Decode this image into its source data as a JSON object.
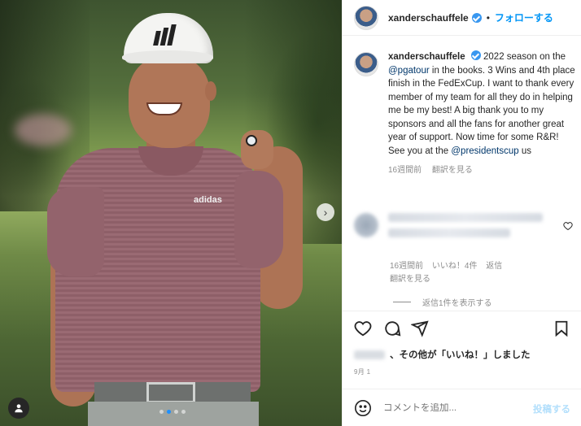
{
  "post": {
    "username": "xanderschauffele",
    "follow_label": "フォローする",
    "separator": "•",
    "caption": {
      "part1": " 2022 season on the ",
      "mention1": "@pgatour",
      "part2": " in the books. 3 Wins and 4th place finish in the FedExCup. I want to thank every member of my team for all they do in helping me be my best! A big thank you to my sponsors and all the fans for another great year of support. Now time for some R&R! See you at the ",
      "mention2": "@presidentscup",
      "part3": " us"
    },
    "caption_meta": {
      "age": "16週間前",
      "translate": "翻訳を見る"
    },
    "comment_meta": {
      "age": "16週間前",
      "likes": "いいね！4件",
      "reply": "返信",
      "translate": "翻訳を見る"
    },
    "view_replies": "返信1件を表示する",
    "likes_text": "、その他が「いいね！」しました",
    "date": "9月 1",
    "add_comment_placeholder": "コメントを追加...",
    "post_button": "投稿する",
    "photo_text": {
      "brand": "adidas"
    }
  },
  "carousel": {
    "count": 4,
    "active_index": 1
  },
  "colors": {
    "accent": "#0095f6",
    "verified": "#3897f0",
    "muted": "#8e8e8e"
  },
  "icons": [
    "verified-badge-icon",
    "chevron-right-icon",
    "user-tag-icon",
    "heart-icon",
    "comment-icon",
    "share-icon",
    "bookmark-icon",
    "emoji-icon"
  ]
}
